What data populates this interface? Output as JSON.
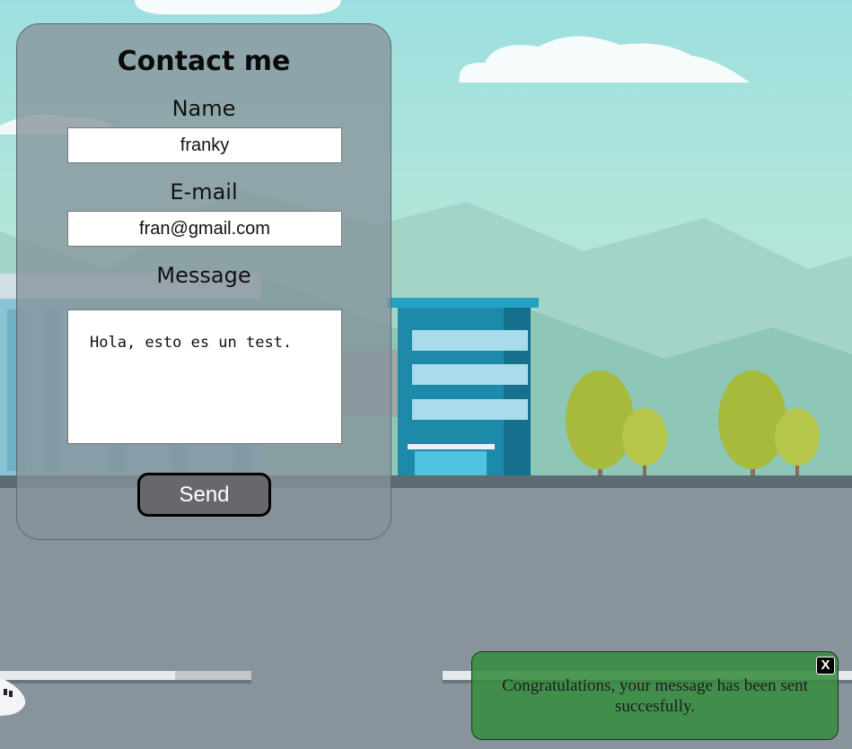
{
  "contact_form": {
    "title": "Contact me",
    "name_label": "Name",
    "name_value": "franky",
    "email_label": "E-mail",
    "email_value": "fran@gmail.com",
    "message_label": "Message",
    "message_value": "Hola, esto es un test.",
    "send_label": "Send"
  },
  "notification": {
    "message": "Congratulations, your message has been sent succesfully.",
    "close_label": "X"
  },
  "colors": {
    "sky_top": "#9edfe0",
    "sky_bottom": "#c8ecd4",
    "ground": "#87949c",
    "building_blue": "#1e8aa9",
    "tree_green": "#a6bb3c",
    "toast_green": "#388c40"
  }
}
